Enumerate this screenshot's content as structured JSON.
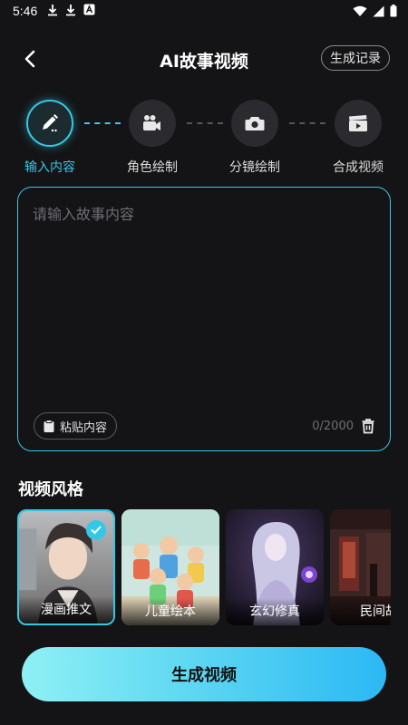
{
  "status_bar": {
    "time": "5:46"
  },
  "header": {
    "title": "AI故事视频",
    "history_label": "生成记录"
  },
  "steps": [
    {
      "label": "输入内容",
      "icon": "pencil-icon",
      "active": true
    },
    {
      "label": "角色绘制",
      "icon": "camcorder-icon",
      "active": false
    },
    {
      "label": "分镜绘制",
      "icon": "camera-icon",
      "active": false
    },
    {
      "label": "合成视频",
      "icon": "clapperboard-icon",
      "active": false
    }
  ],
  "story": {
    "placeholder": "请输入故事内容",
    "value": "",
    "paste_label": "粘贴内容",
    "char_count": "0/2000"
  },
  "styles": {
    "title": "视频风格",
    "items": [
      {
        "label": "漫画推文",
        "selected": true
      },
      {
        "label": "儿童绘本",
        "selected": false
      },
      {
        "label": "玄幻修真",
        "selected": false
      },
      {
        "label": "民间故",
        "selected": false
      }
    ]
  },
  "generate_label": "生成视频",
  "colors": {
    "accent": "#35c8e6",
    "background": "#141416"
  }
}
